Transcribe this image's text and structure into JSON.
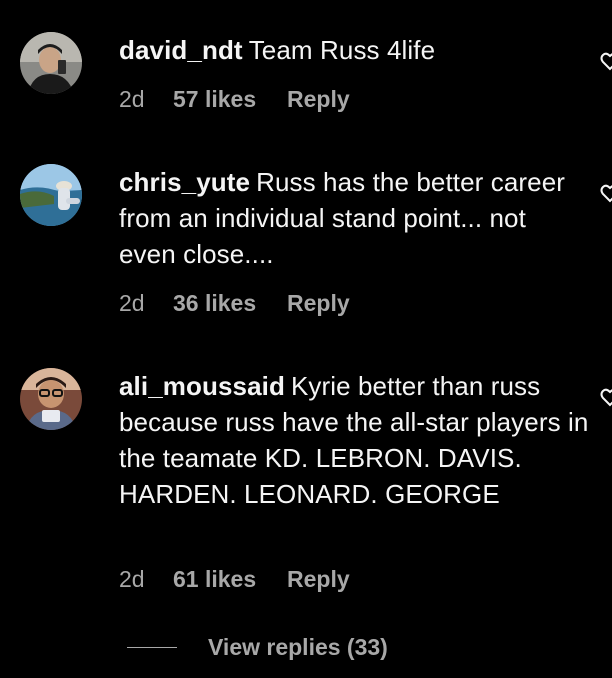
{
  "comments": [
    {
      "username": "david_ndt",
      "text": "Team Russ 4life",
      "age": "2d",
      "likes": "57 likes",
      "reply": "Reply"
    },
    {
      "username": "chris_yute",
      "text": "Russ has the better career from an individual stand point... not even close....",
      "age": "2d",
      "likes": "36 likes",
      "reply": "Reply"
    },
    {
      "username": "ali_moussaid",
      "text": "Kyrie better than russ because russ have the all-star players in the teamate KD. LEBRON. DAVIS. HARDEN. LEONARD. GEORGE",
      "age": "2d",
      "likes": "61 likes",
      "reply": "Reply"
    }
  ],
  "view_replies": "View replies (33)",
  "icons": {
    "heart": "heart-icon"
  },
  "colors": {
    "background": "#000000",
    "primary_text": "#f5f5f5",
    "secondary_text": "#a8a8a8"
  }
}
